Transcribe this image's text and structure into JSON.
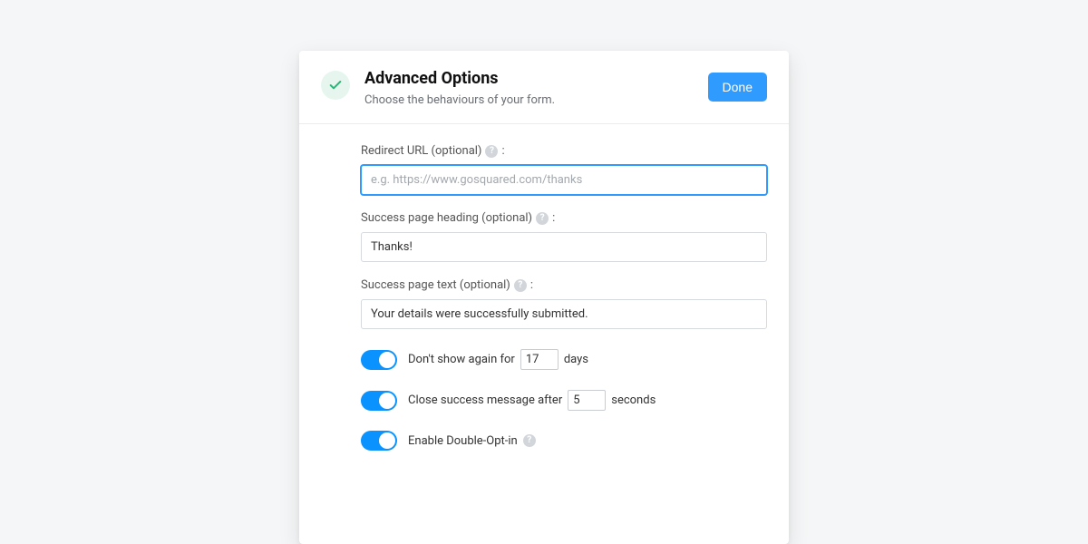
{
  "header": {
    "title": "Advanced Options",
    "subtitle": "Choose the behaviours of your form.",
    "done_label": "Done"
  },
  "fields": {
    "redirect": {
      "label": "Redirect URL (optional)",
      "colon": ":",
      "placeholder": "e.g. https://www.gosquared.com/thanks",
      "value": ""
    },
    "success_heading": {
      "label": "Success page heading (optional)",
      "colon": ":",
      "value": "Thanks!"
    },
    "success_text": {
      "label": "Success page text (optional)",
      "colon": ":",
      "value": "Your details were successfully submitted."
    }
  },
  "toggles": {
    "dont_show": {
      "prefix": "Don't show again for",
      "value": "17",
      "suffix": "days",
      "on": true
    },
    "close_after": {
      "prefix": "Close success message after",
      "value": "5",
      "suffix": "seconds",
      "on": true
    },
    "double_opt_in": {
      "label": "Enable Double-Opt-in",
      "on": true
    }
  }
}
